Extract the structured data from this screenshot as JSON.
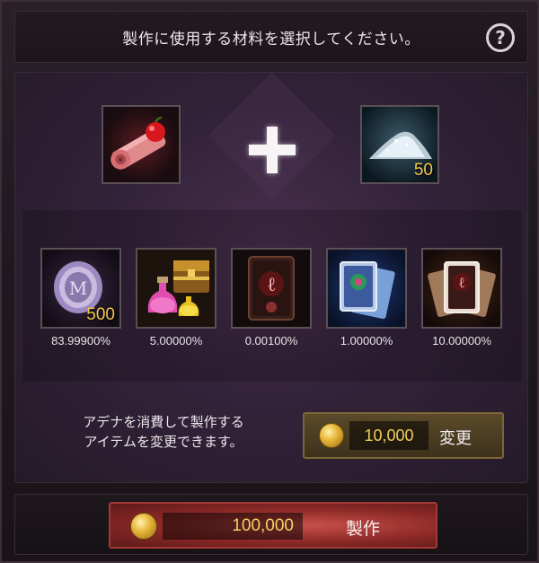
{
  "header": {
    "title": "製作に使用する材料を選択してください。",
    "help_symbol": "?"
  },
  "materials": [
    {
      "icon": "scroll-with-apple-icon",
      "count": ""
    },
    {
      "icon": "crystal-powder-icon",
      "count": "50"
    }
  ],
  "results": [
    {
      "icon": "silver-coin-icon",
      "count": "500",
      "rate": "83.99900%"
    },
    {
      "icon": "potion-and-chest-icon",
      "count": "",
      "rate": "5.00000%"
    },
    {
      "icon": "red-card-icon",
      "count": "",
      "rate": "0.00100%"
    },
    {
      "icon": "blue-card-stack-icon",
      "count": "",
      "rate": "1.00000%"
    },
    {
      "icon": "red-card-stack-icon",
      "count": "",
      "rate": "10.00000%"
    }
  ],
  "change_note": {
    "line1": "アデナを消費して製作する",
    "line2": "アイテムを変更できます。"
  },
  "change_button": {
    "cost": "10,000",
    "label": "変更"
  },
  "craft_button": {
    "cost": "100,000",
    "label": "製作"
  },
  "colors": {
    "gold_text": "#f4cc5a",
    "craft_red": "#8a2826",
    "change_brown": "#3e321c"
  }
}
